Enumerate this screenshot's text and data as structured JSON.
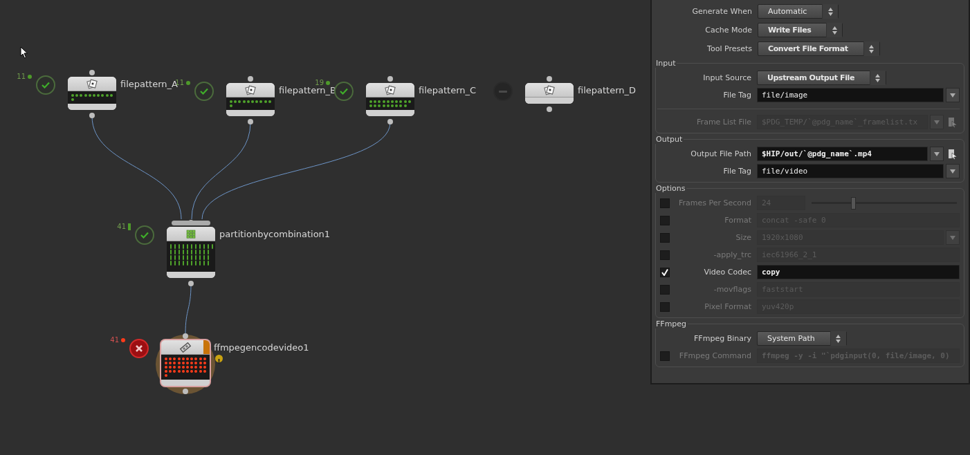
{
  "network": {
    "nodes": [
      {
        "name": "filepattern_A",
        "count": "11",
        "succeeded": true,
        "failed": false,
        "kind": "filepattern"
      },
      {
        "name": "filepattern_B",
        "count": "11",
        "succeeded": true,
        "failed": false,
        "kind": "filepattern"
      },
      {
        "name": "filepattern_C",
        "count": "19",
        "succeeded": true,
        "failed": false,
        "kind": "filepattern"
      },
      {
        "name": "filepattern_D",
        "succeeded": false,
        "failed": false,
        "kind": "filepattern"
      },
      {
        "name": "partitionbycombination1",
        "count": "41",
        "succeeded": true,
        "failed": false,
        "kind": "partition"
      },
      {
        "name": "ffmpegencodevideo1",
        "count": "41",
        "succeeded": false,
        "failed": true,
        "kind": "ffmpeg",
        "warning": true
      }
    ]
  },
  "parameters": {
    "top": [
      {
        "label": "Generate When",
        "kind": "menu",
        "value": "Automatic",
        "emphasized": false
      },
      {
        "label": "Cache Mode",
        "kind": "menu",
        "value": "Write Files",
        "emphasized": true
      },
      {
        "label": "Tool Presets",
        "kind": "menu",
        "value": "Convert File Format",
        "emphasized": true
      }
    ],
    "sections": [
      {
        "title": "Input",
        "rows": [
          {
            "label": "Input Source",
            "kind": "menu",
            "value": "Upstream Output File",
            "emphasized": true
          },
          {
            "label": "File Tag",
            "kind": "string",
            "value": "file/image",
            "dropdown": true
          },
          {
            "kind": "separator"
          },
          {
            "label": "Frame List File",
            "kind": "string",
            "value": "$PDG_TEMP/`@pdg_name`_framelist.tx",
            "dropdown": true,
            "file_button": true,
            "disabled": true
          }
        ]
      },
      {
        "title": "Output",
        "rows": [
          {
            "label": "Output File Path",
            "kind": "string",
            "value": "$HIP/out/`@pdg_name`.mp4",
            "dropdown": true,
            "file_button": true,
            "emphasized": true
          },
          {
            "label": "File Tag",
            "kind": "string",
            "value": "file/video",
            "dropdown": true
          }
        ]
      },
      {
        "title": "Options",
        "rows": [
          {
            "label": "Frames Per Second",
            "kind": "slider",
            "value": "24",
            "checked": false,
            "level": 0.28
          },
          {
            "label": "Format",
            "kind": "string",
            "value": "concat -safe 0",
            "checked": false
          },
          {
            "label": "Size",
            "kind": "string",
            "value": "1920x1080",
            "checked": false,
            "dropdown": true
          },
          {
            "label": "-apply_trc",
            "kind": "string",
            "value": "iec61966_2_1",
            "checked": false
          },
          {
            "label": "Video Codec",
            "kind": "string",
            "value": "copy",
            "checked": true,
            "emphasized": true
          },
          {
            "label": "-movflags",
            "kind": "string",
            "value": "faststart",
            "checked": false
          },
          {
            "label": "Pixel Format",
            "kind": "string",
            "value": "yuv420p",
            "checked": false
          }
        ]
      },
      {
        "title": "FFmpeg",
        "rows": [
          {
            "label": "FFmpeg Binary",
            "kind": "menu",
            "value": "System Path",
            "emphasized": false
          },
          {
            "label": "FFmpeg Command",
            "kind": "string",
            "value": "ffmpeg -y -i \"`pdginput(0, file/image, 0)",
            "checked": false,
            "emphasized": true
          }
        ]
      }
    ]
  }
}
